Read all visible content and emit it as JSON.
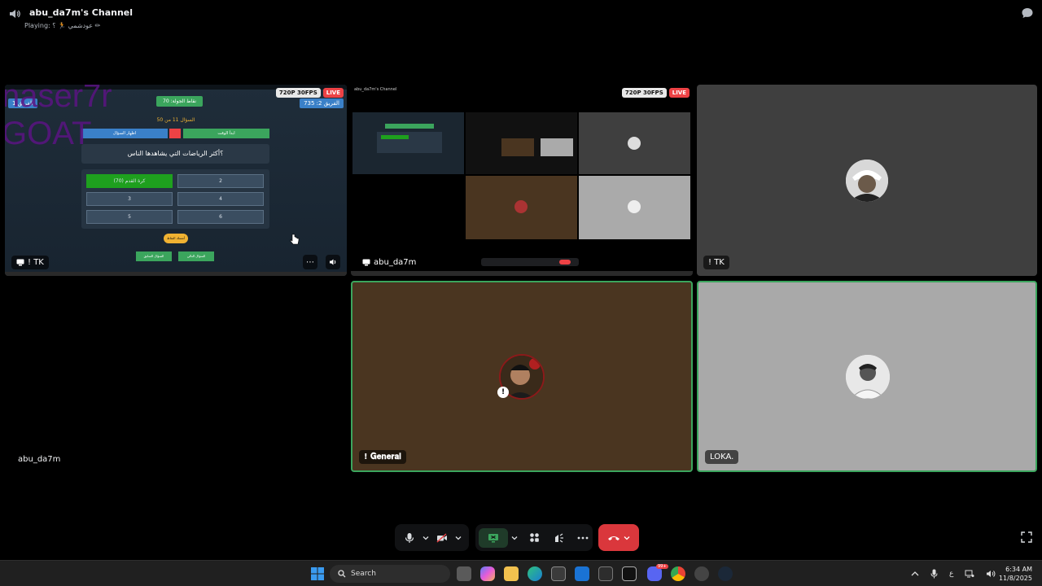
{
  "header": {
    "channel_title": "abu_da7m's Channel",
    "activity": "Playing: ‎‏عودشمي‏ 🏃 ؟ ✏"
  },
  "stream_badges": {
    "quality": "720P 30FPS",
    "live": "LIVE"
  },
  "tiles": {
    "stream1": {
      "name": "! TK",
      "game": {
        "score_label": "نقاط الجولة: 70",
        "team_right": "الفريق 2: 735",
        "team_left": "الفريق 1",
        "question_number": "السؤال 11 من 50",
        "bar_left": "اظهار السؤال",
        "bar_right": "ابدأ الوقت",
        "question": "؟أكثر الرياضات التي يشاهدها الناس",
        "answers": [
          "كرة القدم (70)",
          "2",
          "3",
          "4",
          "5",
          "6"
        ],
        "yellow_button": "أمسك النقاط",
        "green_button_1": "السؤال السابق",
        "green_button_2": "السؤال التالي",
        "overlay_line1": "naser7r",
        "overlay_line2": "GOAT"
      }
    },
    "stream2": {
      "name": "abu_da7m",
      "nested_title": "abu_da7m's Channel"
    },
    "user_tk": {
      "name": "! TK"
    },
    "user_abu": {
      "name": "abu_da7m"
    },
    "user_general": {
      "name": "! 𝐆𝐞𝐧𝐞𝐫𝐚𝐥"
    },
    "user_loka": {
      "name": "LOKA."
    }
  },
  "taskbar": {
    "search_placeholder": "Search",
    "time": "6:34 AM",
    "date": "11/8/2025",
    "ime_indicator": "ع",
    "discord_badge": "99+"
  },
  "colors": {
    "speaking_border": "#3ba55d",
    "leave_button": "#da373c",
    "live_badge": "#ed4245"
  }
}
